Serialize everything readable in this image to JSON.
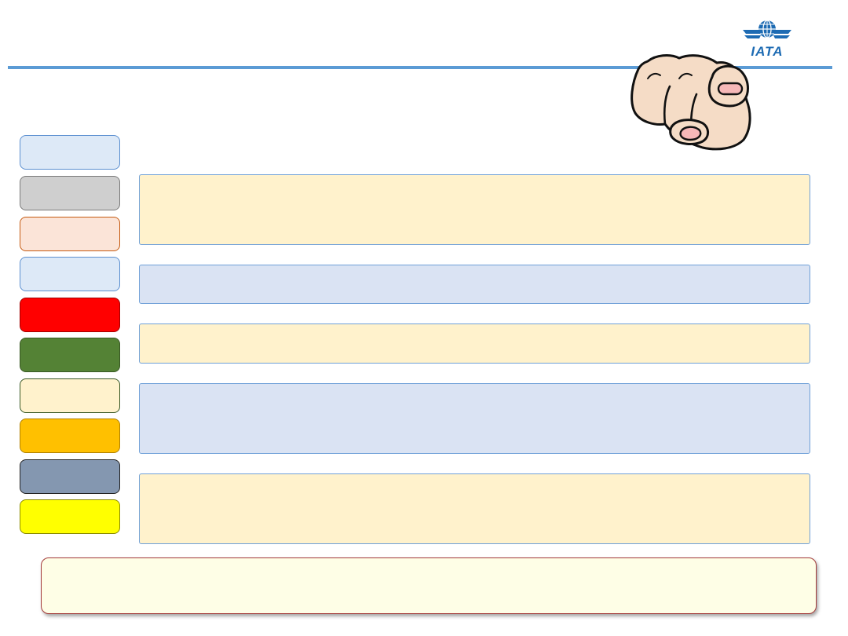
{
  "logo": {
    "text": "IATA",
    "icon": "iata-globe-icon",
    "brand_color": "#1d6bb3"
  },
  "header": {
    "line_color": "#5b9bd5"
  },
  "decoration": {
    "icon": "pointing-hand-icon"
  },
  "legend": {
    "swatches": [
      {
        "name": "light-blue",
        "fill": "#dde9f7",
        "border": "#5b8fd0"
      },
      {
        "name": "light-gray",
        "fill": "#cfcfcf",
        "border": "#7a7a7a"
      },
      {
        "name": "peach",
        "fill": "#fbe4d8",
        "border": "#c55a11"
      },
      {
        "name": "light-blue-2",
        "fill": "#dde9f7",
        "border": "#5b8fd0"
      },
      {
        "name": "red",
        "fill": "#ff0000",
        "border": "#a00000"
      },
      {
        "name": "green",
        "fill": "#548235",
        "border": "#385723"
      },
      {
        "name": "cream",
        "fill": "#fff2cc",
        "border": "#385723"
      },
      {
        "name": "amber",
        "fill": "#ffc000",
        "border": "#b08000"
      },
      {
        "name": "slate",
        "fill": "#8497b0",
        "border": "#222222"
      },
      {
        "name": "yellow",
        "fill": "#ffff00",
        "border": "#8a8a00"
      }
    ]
  },
  "content_boxes": [
    {
      "name": "content-box-1",
      "fill": "#fff2cc"
    },
    {
      "name": "content-box-2",
      "fill": "#dae3f3"
    },
    {
      "name": "content-box-3",
      "fill": "#fff2cc"
    },
    {
      "name": "content-box-4",
      "fill": "#dae3f3"
    },
    {
      "name": "content-box-5",
      "fill": "#fff2cc"
    }
  ],
  "footer": {
    "fill": "#fefee6",
    "border": "#a33a3a"
  }
}
